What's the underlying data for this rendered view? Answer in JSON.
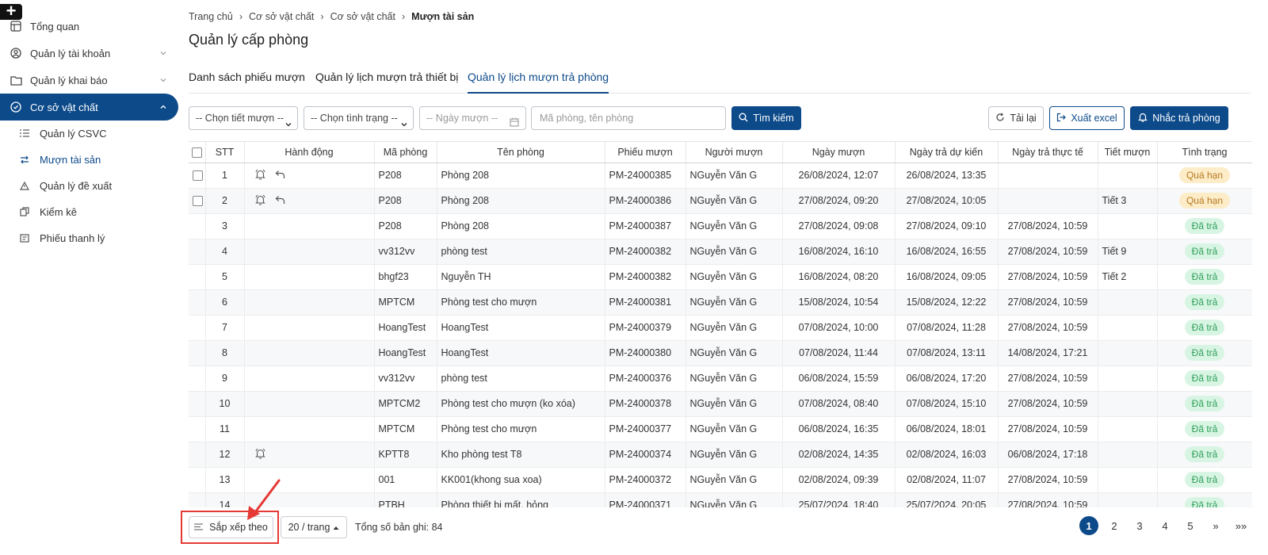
{
  "sidebar": {
    "items": [
      {
        "label": "Tổng quan",
        "icon": "dashboard-icon"
      },
      {
        "label": "Quản lý tài khoản",
        "icon": "user-circle-icon"
      },
      {
        "label": "Quản lý khai báo",
        "icon": "folder-icon"
      },
      {
        "label": "Cơ sở vật chất",
        "icon": "check-circle-icon"
      }
    ],
    "subitems": [
      {
        "label": "Quản lý CSVC",
        "icon": "list-icon"
      },
      {
        "label": "Mượn tài sản",
        "icon": "swap-icon"
      },
      {
        "label": "Quản lý đề xuất",
        "icon": "warning-icon"
      },
      {
        "label": "Kiểm kê",
        "icon": "copy-icon"
      },
      {
        "label": "Phiếu thanh lý",
        "icon": "receipt-icon"
      }
    ]
  },
  "breadcrumb": [
    "Trang chủ",
    "Cơ sở vật chất",
    "Cơ sở vật chất",
    "Mượn tài sản"
  ],
  "page_title": "Quản lý cấp phòng",
  "tabs": [
    "Danh sách phiếu mượn",
    "Quản lý lịch mượn trả thiết bị",
    "Quản lý lịch mượn trả phòng"
  ],
  "filters": {
    "period": "-- Chọn tiết mượn --",
    "status": "-- Chọn tình trạng --",
    "date_placeholder": "-- Ngày mượn --",
    "search_placeholder": "Mã phòng, tên phòng",
    "search_button": "Tìm kiếm",
    "reload_button": "Tải lại",
    "export_button": "Xuất excel",
    "remind_button": "Nhắc trả phòng"
  },
  "table": {
    "headers": [
      "STT",
      "Hành động",
      "Mã phòng",
      "Tên phòng",
      "Phiếu mượn",
      "Người mượn",
      "Ngày mượn",
      "Ngày trả dự kiến",
      "Ngày trả thực tế",
      "Tiết mượn",
      "Tình trạng"
    ],
    "rows": [
      {
        "stt": "1",
        "checkbox": true,
        "bell": true,
        "undo": true,
        "code": "P208",
        "name": "Phòng 208",
        "ticket": "PM-24000385",
        "borrower": "NGuyễn Văn G",
        "borrow_date": "26/08/2024, 12:07",
        "expected": "26/08/2024, 13:35",
        "actual": "",
        "period": "",
        "status": "Quá hạn",
        "status_type": "overdue"
      },
      {
        "stt": "2",
        "checkbox": true,
        "bell": true,
        "undo": true,
        "code": "P208",
        "name": "Phòng 208",
        "ticket": "PM-24000386",
        "borrower": "NGuyễn Văn G",
        "borrow_date": "27/08/2024, 09:20",
        "expected": "27/08/2024, 10:05",
        "actual": "",
        "period": "Tiết 3",
        "status": "Quá hạn",
        "status_type": "overdue"
      },
      {
        "stt": "3",
        "checkbox": false,
        "bell": false,
        "undo": false,
        "code": "P208",
        "name": "Phòng 208",
        "ticket": "PM-24000387",
        "borrower": "NGuyễn Văn G",
        "borrow_date": "27/08/2024, 09:08",
        "expected": "27/08/2024, 09:10",
        "actual": "27/08/2024, 10:59",
        "period": "",
        "status": "Đã trả",
        "status_type": "returned"
      },
      {
        "stt": "4",
        "checkbox": false,
        "bell": false,
        "undo": false,
        "code": "vv312vv",
        "name": "phòng test",
        "ticket": "PM-24000382",
        "borrower": "NGuyễn Văn G",
        "borrow_date": "16/08/2024, 16:10",
        "expected": "16/08/2024, 16:55",
        "actual": "27/08/2024, 10:59",
        "period": "Tiết 9",
        "status": "Đã trả",
        "status_type": "returned"
      },
      {
        "stt": "5",
        "checkbox": false,
        "bell": false,
        "undo": false,
        "code": "bhgf23",
        "name": "Nguyễn TH",
        "ticket": "PM-24000382",
        "borrower": "NGuyễn Văn G",
        "borrow_date": "16/08/2024, 08:20",
        "expected": "16/08/2024, 09:05",
        "actual": "27/08/2024, 10:59",
        "period": "Tiết 2",
        "status": "Đã trả",
        "status_type": "returned"
      },
      {
        "stt": "6",
        "checkbox": false,
        "bell": false,
        "undo": false,
        "code": "MPTCM",
        "name": "Phòng test cho mượn",
        "ticket": "PM-24000381",
        "borrower": "NGuyễn Văn G",
        "borrow_date": "15/08/2024, 10:54",
        "expected": "15/08/2024, 12:22",
        "actual": "27/08/2024, 10:59",
        "period": "",
        "status": "Đã trả",
        "status_type": "returned"
      },
      {
        "stt": "7",
        "checkbox": false,
        "bell": false,
        "undo": false,
        "code": "HoangTest",
        "name": "HoangTest",
        "ticket": "PM-24000379",
        "borrower": "NGuyễn Văn G",
        "borrow_date": "07/08/2024, 10:00",
        "expected": "07/08/2024, 11:28",
        "actual": "27/08/2024, 10:59",
        "period": "",
        "status": "Đã trả",
        "status_type": "returned"
      },
      {
        "stt": "8",
        "checkbox": false,
        "bell": false,
        "undo": false,
        "code": "HoangTest",
        "name": "HoangTest",
        "ticket": "PM-24000380",
        "borrower": "NGuyễn Văn G",
        "borrow_date": "07/08/2024, 11:44",
        "expected": "07/08/2024, 13:11",
        "actual": "14/08/2024, 17:21",
        "period": "",
        "status": "Đã trả",
        "status_type": "returned"
      },
      {
        "stt": "9",
        "checkbox": false,
        "bell": false,
        "undo": false,
        "code": "vv312vv",
        "name": "phòng test",
        "ticket": "PM-24000376",
        "borrower": "NGuyễn Văn G",
        "borrow_date": "06/08/2024, 15:59",
        "expected": "06/08/2024, 17:20",
        "actual": "27/08/2024, 10:59",
        "period": "",
        "status": "Đã trả",
        "status_type": "returned"
      },
      {
        "stt": "10",
        "checkbox": false,
        "bell": false,
        "undo": false,
        "code": "MPTCM2",
        "name": "Phòng test cho mượn (ko xóa)",
        "ticket": "PM-24000378",
        "borrower": "NGuyễn Văn G",
        "borrow_date": "07/08/2024, 08:40",
        "expected": "07/08/2024, 15:10",
        "actual": "27/08/2024, 10:59",
        "period": "",
        "status": "Đã trả",
        "status_type": "returned"
      },
      {
        "stt": "11",
        "checkbox": false,
        "bell": false,
        "undo": false,
        "code": "MPTCM",
        "name": "Phòng test cho mượn",
        "ticket": "PM-24000377",
        "borrower": "NGuyễn Văn G",
        "borrow_date": "06/08/2024, 16:35",
        "expected": "06/08/2024, 18:01",
        "actual": "27/08/2024, 10:59",
        "period": "",
        "status": "Đã trả",
        "status_type": "returned"
      },
      {
        "stt": "12",
        "checkbox": false,
        "bell": true,
        "undo": false,
        "code": "KPTT8",
        "name": "Kho phòng test T8",
        "ticket": "PM-24000374",
        "borrower": "NGuyễn Văn G",
        "borrow_date": "02/08/2024, 14:35",
        "expected": "02/08/2024, 16:03",
        "actual": "06/08/2024, 17:18",
        "period": "",
        "status": "Đã trả",
        "status_type": "returned"
      },
      {
        "stt": "13",
        "checkbox": false,
        "bell": false,
        "undo": false,
        "code": "001",
        "name": "KK001(khong sua xoa)",
        "ticket": "PM-24000372",
        "borrower": "NGuyễn Văn G",
        "borrow_date": "02/08/2024, 09:39",
        "expected": "02/08/2024, 11:07",
        "actual": "27/08/2024, 10:59",
        "period": "",
        "status": "Đã trả",
        "status_type": "returned"
      },
      {
        "stt": "14",
        "checkbox": false,
        "bell": false,
        "undo": false,
        "code": "PTBH",
        "name": "Phòng thiết bị mất, hỏng",
        "ticket": "PM-24000371",
        "borrower": "NGuyễn Văn G",
        "borrow_date": "25/07/2024, 18:40",
        "expected": "25/07/2024, 20:05",
        "actual": "27/08/2024, 10:59",
        "period": "",
        "status": "Đã trả",
        "status_type": "returned"
      }
    ]
  },
  "footer": {
    "sort_label": "Sắp xếp theo",
    "per_page": "20 / trang",
    "total": "Tổng số bản ghi: 84",
    "pages": [
      "1",
      "2",
      "3",
      "4",
      "5"
    ],
    "current_page": "1",
    "next": "»",
    "last": "»»"
  },
  "colors": {
    "primary": "#0d4a8a",
    "overdue_bg": "#fdecc8",
    "overdue_fg": "#b7791f",
    "returned_bg": "#d8f5e3",
    "returned_fg": "#2f9e5b",
    "annotation": "#e53935"
  }
}
